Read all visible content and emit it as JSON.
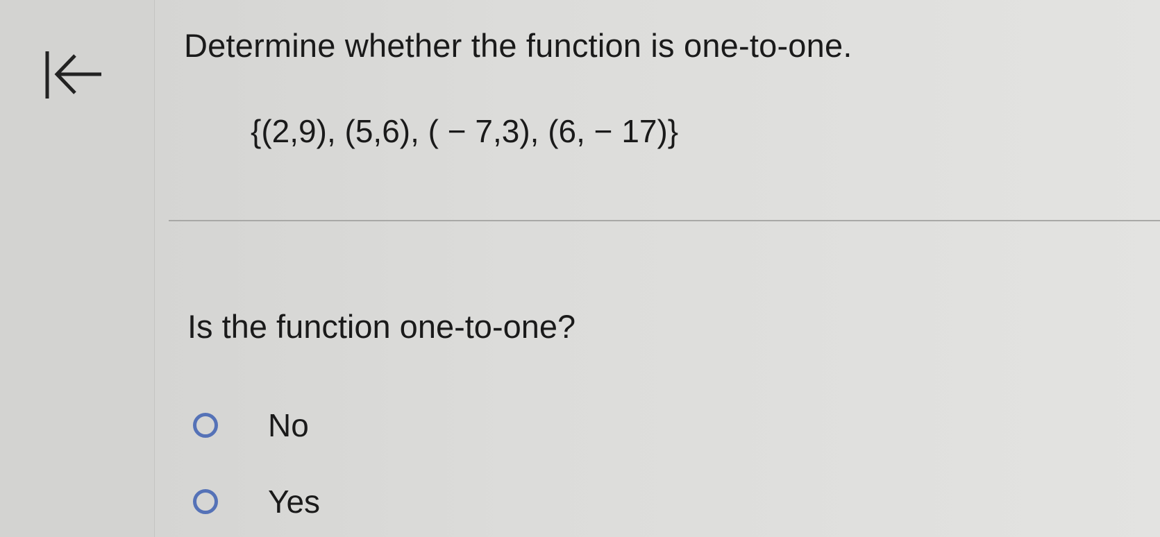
{
  "navigation": {
    "first_icon": "first-page-arrow-icon"
  },
  "question": {
    "title": "Determine whether the function is one-to-one.",
    "set_expression": "{(2,9), (5,6), ( − 7,3), (6, − 17)}",
    "prompt": "Is the function one-to-one?",
    "options": [
      {
        "label": "No",
        "selected": false
      },
      {
        "label": "Yes",
        "selected": false
      }
    ]
  },
  "colors": {
    "radio_outline": "#5572b7",
    "text": "#1a1a1a",
    "background": "#dcdcda"
  }
}
